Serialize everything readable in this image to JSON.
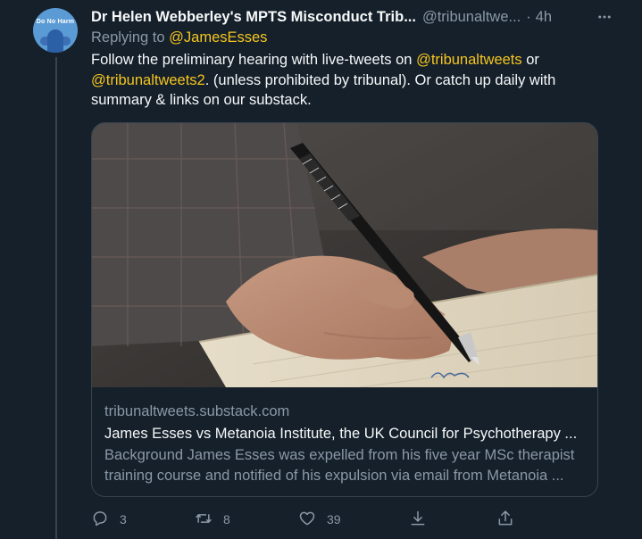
{
  "tweet": {
    "avatar_text": "Do No Harm",
    "author_name": "Dr Helen Webberley's MPTS Misconduct Trib...",
    "author_handle": "@tribunaltwe...",
    "separator": "·",
    "time": "4h",
    "replying_prefix": "Replying to",
    "replying_to": "@JamesEsses",
    "text_part1": "Follow the preliminary hearing with live-tweets on ",
    "mention1": "@tribunaltweets",
    "text_part2": " or ",
    "mention2": "@tribunaltweets2",
    "text_part3": ". (unless prohibited by tribunal).  Or catch up daily with summary & links on our substack.",
    "card": {
      "domain": "tribunaltweets.substack.com",
      "title": "James Esses vs Metanoia Institute, the UK Council for Psychotherapy ...",
      "desc_line1": "Background James Esses was expelled from his five year MSc therapist",
      "desc_line2": "training course and notified of his expulsion via email from Metanoia ..."
    },
    "actions": {
      "reply_count": "3",
      "retweet_count": "8",
      "like_count": "39"
    }
  },
  "colors": {
    "background": "#15202b",
    "link": "#f5c51f",
    "secondary_text": "#8b98a5",
    "border": "#38444d"
  }
}
